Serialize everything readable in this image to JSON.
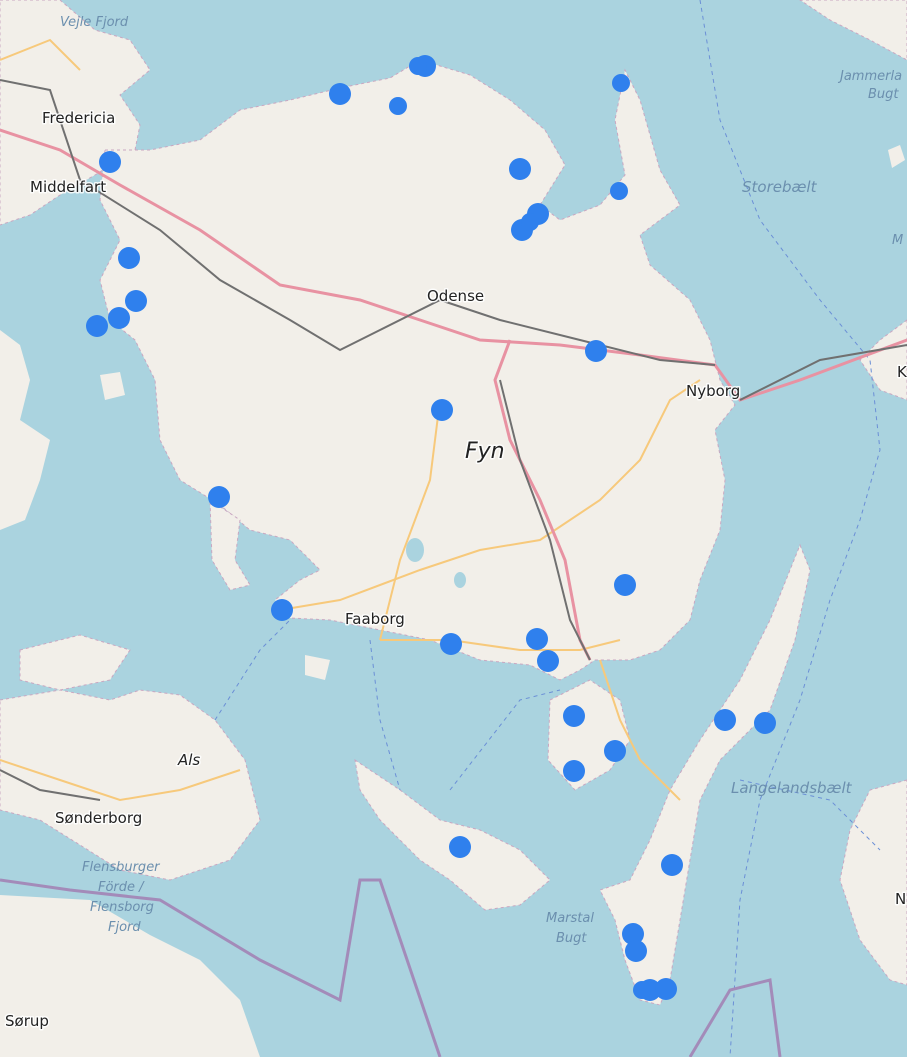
{
  "map": {
    "colors": {
      "water": "#aad3df",
      "land": "#f2efe9",
      "marker": "#2f80ed",
      "motorway": "#e892a2",
      "rail": "#707070",
      "secondary": "#f7c97b",
      "border": "#a38bb9"
    },
    "labels": {
      "fyn": "Fyn",
      "odense": "Odense",
      "nyborg": "Nyborg",
      "faaborg": "Faaborg",
      "middelfart": "Middelfart",
      "fredericia": "Fredericia",
      "sonderborg": "Sønderborg",
      "als": "Als",
      "sorup": "Sørup",
      "vejle_fjord": "Vejle Fjord",
      "storebaelt": "Storebælt",
      "langelandsbaelt": "Langelandsbælt",
      "jammerland": "Jammerla",
      "bugt": "Bugt",
      "marstal_1": "Marstal",
      "marstal_2": "Bugt",
      "flensburger_1": "Flensburger",
      "flensburger_2": "Förde /",
      "flensburger_3": "Flensborg",
      "flensburger_4": "Fjord",
      "edge_k": "K",
      "edge_m": "M",
      "edge_n": "N"
    },
    "marker_count": 35,
    "marker_icon": "circle-marker"
  }
}
